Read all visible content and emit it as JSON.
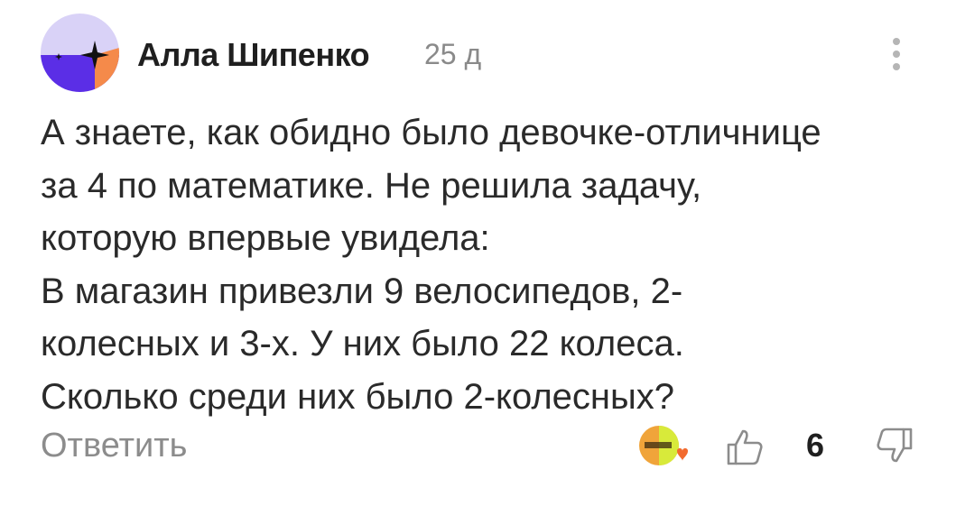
{
  "comment": {
    "author": "Алла Шипенко",
    "time": "25 д",
    "lines": [
      "А знаете, как обидно было девочке-отличнице",
      "за 4 по математике. Не решила задачу,",
      "которую впервые увидела:",
      "В магазин привезли 9 велосипедов, 2-",
      "колесных и 3-х. У них было 22 колеса.",
      "Сколько среди них было 2-колесных?"
    ],
    "reply_label": "Ответить",
    "likes": "6"
  },
  "icons": {
    "more": "more-vertical-icon",
    "reaction": "reaction-emoji-icon",
    "like": "thumbs-up-icon",
    "dislike": "thumbs-down-icon"
  },
  "colors": {
    "avatar_top": "#d9d2f7",
    "avatar_bottom": "#5b2ee6",
    "avatar_accent": "#f58a4a",
    "reaction_yellow": "#d8ea3a",
    "reaction_orange": "#f0a43a",
    "reaction_heart": "#f26a2e",
    "muted_text": "#8c8c8c"
  }
}
